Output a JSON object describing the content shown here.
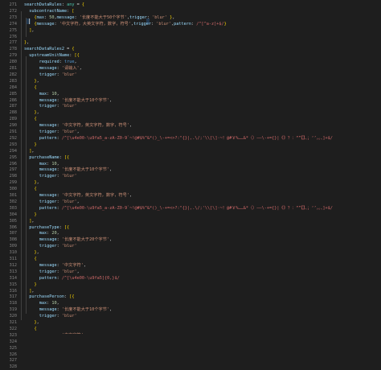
{
  "editor": {
    "lines": [
      {
        "n": "271",
        "segs": [
          [
            "k",
            "searchDataRules"
          ],
          [
            "p",
            ": "
          ],
          [
            "t",
            "any"
          ],
          [
            "p",
            " = "
          ],
          [
            "b",
            "{"
          ]
        ]
      },
      {
        "n": "272",
        "segs": [
          [
            "p",
            "  "
          ],
          [
            "k",
            "subcontractName"
          ],
          [
            "p",
            ": "
          ],
          [
            "b",
            "["
          ]
        ]
      },
      {
        "n": "273",
        "segs": [
          [
            "p",
            "    "
          ],
          [
            "b",
            "{"
          ],
          [
            "k",
            "max"
          ],
          [
            "p",
            ": "
          ],
          [
            "n",
            "50"
          ],
          [
            "p",
            ","
          ],
          [
            "k",
            "message"
          ],
          [
            "p",
            ": "
          ],
          [
            "s",
            "'长度不能大于50个字节'"
          ],
          [
            "p",
            ","
          ],
          [
            "k",
            "trigger"
          ],
          [
            "p",
            ": "
          ],
          [
            "s",
            "'blur'"
          ],
          [
            "p",
            " "
          ],
          [
            "b",
            "}"
          ],
          [
            "p",
            ","
          ]
        ]
      },
      {
        "n": "274",
        "segs": [
          [
            "p",
            "    "
          ],
          [
            "b",
            "{"
          ],
          [
            "k",
            "message"
          ],
          [
            "p",
            ": "
          ],
          [
            "s",
            "'中文字符，大英文字符，数字，符号'"
          ],
          [
            "p",
            ","
          ],
          [
            "k",
            "trigger"
          ],
          [
            "p",
            ": "
          ],
          [
            "s",
            "'blur'"
          ],
          [
            "p",
            ","
          ],
          [
            "k",
            "pattern"
          ],
          [
            "p",
            ": "
          ],
          [
            "r",
            "/^[^a-z]+$/"
          ],
          [
            "b",
            "}"
          ]
        ]
      },
      {
        "n": "275",
        "segs": [
          [
            "p",
            "  "
          ],
          [
            "b",
            "]"
          ],
          [
            "p",
            ","
          ]
        ]
      },
      {
        "n": "276",
        "segs": []
      },
      {
        "n": "277",
        "segs": [
          [
            "b",
            "}"
          ],
          [
            "p",
            ","
          ]
        ]
      },
      {
        "n": "278",
        "segs": [
          [
            "k",
            "searchDataRules2"
          ],
          [
            "p",
            " = "
          ],
          [
            "b",
            "{"
          ]
        ]
      },
      {
        "n": "279",
        "segs": [
          [
            "p",
            "  "
          ],
          [
            "k",
            "upstreamUnitName"
          ],
          [
            "p",
            ": "
          ],
          [
            "b",
            "[{"
          ]
        ]
      },
      {
        "n": "280",
        "segs": [
          [
            "p",
            "      "
          ],
          [
            "k",
            "required"
          ],
          [
            "p",
            ": "
          ],
          [
            "kw",
            "true"
          ],
          [
            "p",
            ","
          ]
        ]
      },
      {
        "n": "281",
        "segs": [
          [
            "p",
            "      "
          ],
          [
            "k",
            "message"
          ],
          [
            "p",
            ": "
          ],
          [
            "s",
            "'请输入'"
          ],
          [
            "p",
            ","
          ]
        ]
      },
      {
        "n": "282",
        "segs": [
          [
            "p",
            "      "
          ],
          [
            "k",
            "trigger"
          ],
          [
            "p",
            ": "
          ],
          [
            "s",
            "'blur'"
          ]
        ]
      },
      {
        "n": "283",
        "segs": [
          [
            "p",
            "    "
          ],
          [
            "b",
            "}"
          ],
          [
            "p",
            ","
          ]
        ]
      },
      {
        "n": "284",
        "segs": [
          [
            "p",
            "    "
          ],
          [
            "b",
            "{"
          ]
        ]
      },
      {
        "n": "285",
        "segs": [
          [
            "p",
            "      "
          ],
          [
            "k",
            "max"
          ],
          [
            "p",
            ": "
          ],
          [
            "n",
            "10"
          ],
          [
            "p",
            ","
          ]
        ]
      },
      {
        "n": "286",
        "segs": [
          [
            "p",
            "      "
          ],
          [
            "k",
            "message"
          ],
          [
            "p",
            ": "
          ],
          [
            "s",
            "'长度不能大于10个字节'"
          ],
          [
            "p",
            ","
          ]
        ]
      },
      {
        "n": "287",
        "segs": [
          [
            "p",
            "      "
          ],
          [
            "k",
            "trigger"
          ],
          [
            "p",
            ": "
          ],
          [
            "s",
            "'blur'"
          ]
        ]
      },
      {
        "n": "288",
        "segs": [
          [
            "p",
            "    "
          ],
          [
            "b",
            "}"
          ],
          [
            "p",
            ","
          ]
        ]
      },
      {
        "n": "289",
        "segs": [
          [
            "p",
            "    "
          ],
          [
            "b",
            "{"
          ]
        ]
      },
      {
        "n": "290",
        "segs": [
          [
            "p",
            "      "
          ],
          [
            "k",
            "message"
          ],
          [
            "p",
            ": "
          ],
          [
            "s",
            "'中文字符，英文字符，数字，符号'"
          ],
          [
            "p",
            ","
          ]
        ]
      },
      {
        "n": "291",
        "segs": [
          [
            "p",
            "      "
          ],
          [
            "k",
            "trigger"
          ],
          [
            "p",
            ": "
          ],
          [
            "s",
            "'blur'"
          ],
          [
            "p",
            ","
          ]
        ]
      },
      {
        "n": "292",
        "segs": [
          [
            "p",
            "      "
          ],
          [
            "k",
            "pattern"
          ],
          [
            "p",
            ": "
          ],
          [
            "r",
            "/^[\\u4e00-\\u9fa5_a-zA-Z0-9`~!@#$%^&*()_\\-+=<>?:\"{}|,.\\/;'\\\\[\\]·~！@#￥%……&*（）——\\-+={}|《》？：“”【】、；‘’，。、]+$/"
          ]
        ]
      },
      {
        "n": "293",
        "segs": [
          [
            "p",
            "    "
          ],
          [
            "b",
            "}"
          ]
        ]
      },
      {
        "n": "294",
        "segs": [
          [
            "p",
            "  "
          ],
          [
            "b",
            "]"
          ],
          [
            "p",
            ","
          ]
        ]
      },
      {
        "n": "295",
        "segs": [
          [
            "p",
            "  "
          ],
          [
            "k",
            "purchaseName"
          ],
          [
            "p",
            ": "
          ],
          [
            "b",
            "[{"
          ]
        ]
      },
      {
        "n": "296",
        "segs": [
          [
            "p",
            "      "
          ],
          [
            "k",
            "max"
          ],
          [
            "p",
            ": "
          ],
          [
            "n",
            "10"
          ],
          [
            "p",
            ","
          ]
        ]
      },
      {
        "n": "297",
        "segs": [
          [
            "p",
            "      "
          ],
          [
            "k",
            "message"
          ],
          [
            "p",
            ": "
          ],
          [
            "s",
            "'长度不能大于10个字节'"
          ],
          [
            "p",
            ","
          ]
        ]
      },
      {
        "n": "298",
        "segs": [
          [
            "p",
            "      "
          ],
          [
            "k",
            "trigger"
          ],
          [
            "p",
            ": "
          ],
          [
            "s",
            "'blur'"
          ]
        ]
      },
      {
        "n": "299",
        "segs": [
          [
            "p",
            "    "
          ],
          [
            "b",
            "}"
          ],
          [
            "p",
            ","
          ]
        ]
      },
      {
        "n": "300",
        "segs": [
          [
            "p",
            "    "
          ],
          [
            "b",
            "{"
          ]
        ]
      },
      {
        "n": "301",
        "segs": [
          [
            "p",
            "      "
          ],
          [
            "k",
            "message"
          ],
          [
            "p",
            ": "
          ],
          [
            "s",
            "'中文字符，英文字符，数字，符号'"
          ],
          [
            "p",
            ","
          ]
        ]
      },
      {
        "n": "302",
        "segs": [
          [
            "p",
            "      "
          ],
          [
            "k",
            "trigger"
          ],
          [
            "p",
            ": "
          ],
          [
            "s",
            "'blur'"
          ],
          [
            "p",
            ","
          ]
        ]
      },
      {
        "n": "303",
        "segs": [
          [
            "p",
            "      "
          ],
          [
            "k",
            "pattern"
          ],
          [
            "p",
            ": "
          ],
          [
            "r",
            "/^[\\u4e00-\\u9fa5_a-zA-Z0-9`~!@#$%^&*()_\\-+=<>?:\"{}|,.\\/;'\\\\[\\]·~！@#￥%……&*（）——\\-+={}|《》？：“”【】、；‘’，。、]+$/"
          ]
        ]
      },
      {
        "n": "304",
        "segs": [
          [
            "p",
            "    "
          ],
          [
            "b",
            "}"
          ]
        ]
      },
      {
        "n": "305",
        "segs": [
          [
            "p",
            "  "
          ],
          [
            "b",
            "]"
          ],
          [
            "p",
            ","
          ]
        ]
      },
      {
        "n": "306",
        "segs": [
          [
            "p",
            "  "
          ],
          [
            "k",
            "purchaseType"
          ],
          [
            "p",
            ": "
          ],
          [
            "b",
            "[{"
          ]
        ]
      },
      {
        "n": "307",
        "segs": [
          [
            "p",
            "      "
          ],
          [
            "k",
            "max"
          ],
          [
            "p",
            ": "
          ],
          [
            "n",
            "20"
          ],
          [
            "p",
            ","
          ]
        ]
      },
      {
        "n": "308",
        "segs": [
          [
            "p",
            "      "
          ],
          [
            "k",
            "message"
          ],
          [
            "p",
            ": "
          ],
          [
            "s",
            "'长度不能大于20个字节'"
          ],
          [
            "p",
            ","
          ]
        ]
      },
      {
        "n": "309",
        "segs": [
          [
            "p",
            "      "
          ],
          [
            "k",
            "trigger"
          ],
          [
            "p",
            ": "
          ],
          [
            "s",
            "'blur'"
          ]
        ]
      },
      {
        "n": "310",
        "segs": [
          [
            "p",
            "    "
          ],
          [
            "b",
            "}"
          ],
          [
            "p",
            ","
          ]
        ]
      },
      {
        "n": "311",
        "segs": [
          [
            "p",
            "    "
          ],
          [
            "b",
            "{"
          ]
        ]
      },
      {
        "n": "312",
        "segs": [
          [
            "p",
            "      "
          ],
          [
            "k",
            "message"
          ],
          [
            "p",
            ": "
          ],
          [
            "s",
            "'中文字符'"
          ],
          [
            "p",
            ","
          ]
        ]
      },
      {
        "n": "313",
        "segs": [
          [
            "p",
            "      "
          ],
          [
            "k",
            "trigger"
          ],
          [
            "p",
            ": "
          ],
          [
            "s",
            "'blur'"
          ],
          [
            "p",
            ","
          ]
        ]
      },
      {
        "n": "314",
        "segs": [
          [
            "p",
            "      "
          ],
          [
            "k",
            "pattern"
          ],
          [
            "p",
            ": "
          ],
          [
            "r",
            "/^[\\u4e00-\\u9fa5]{0,}$/"
          ]
        ]
      },
      {
        "n": "315",
        "segs": [
          [
            "p",
            "    "
          ],
          [
            "b",
            "}"
          ]
        ]
      },
      {
        "n": "316",
        "segs": [
          [
            "p",
            "  "
          ],
          [
            "b",
            "]"
          ],
          [
            "p",
            ","
          ]
        ]
      },
      {
        "n": "317",
        "segs": [
          [
            "p",
            "  "
          ],
          [
            "k",
            "purchasePerson"
          ],
          [
            "p",
            ": "
          ],
          [
            "b",
            "[{"
          ]
        ]
      },
      {
        "n": "318",
        "segs": [
          [
            "p",
            "      "
          ],
          [
            "k",
            "max"
          ],
          [
            "p",
            ": "
          ],
          [
            "n",
            "10"
          ],
          [
            "p",
            ","
          ]
        ]
      },
      {
        "n": "319",
        "segs": [
          [
            "p",
            "      "
          ],
          [
            "k",
            "message"
          ],
          [
            "p",
            ": "
          ],
          [
            "s",
            "'长度不能大于10个字节'"
          ],
          [
            "p",
            ","
          ]
        ]
      },
      {
        "n": "320",
        "segs": [
          [
            "p",
            "      "
          ],
          [
            "k",
            "trigger"
          ],
          [
            "p",
            ": "
          ],
          [
            "s",
            "'blur'"
          ]
        ]
      },
      {
        "n": "321",
        "segs": [
          [
            "p",
            "    "
          ],
          [
            "b",
            "}"
          ],
          [
            "p",
            ","
          ]
        ]
      },
      {
        "n": "322",
        "segs": [
          [
            "p",
            "    "
          ],
          [
            "b",
            "{"
          ]
        ]
      },
      {
        "n": "323",
        "segs": [
          [
            "p",
            "      "
          ],
          [
            "k",
            "message"
          ],
          [
            "p",
            ": "
          ],
          [
            "s",
            "'中文字符'"
          ],
          [
            "p",
            ","
          ]
        ]
      },
      {
        "n": "324",
        "segs": [
          [
            "p",
            "      "
          ],
          [
            "k",
            "trigger"
          ],
          [
            "p",
            ": "
          ],
          [
            "s",
            "'blur'"
          ],
          [
            "p",
            ","
          ]
        ]
      },
      {
        "n": "325",
        "segs": [
          [
            "p",
            "      "
          ],
          [
            "k",
            "pattern"
          ],
          [
            "p",
            ": "
          ],
          [
            "r",
            "/^[\\u4e00-\\u9fa5]{0,}$/"
          ],
          [
            "p",
            ","
          ]
        ]
      },
      {
        "n": "326",
        "segs": [
          [
            "p",
            "    "
          ],
          [
            "b",
            "}"
          ]
        ]
      },
      {
        "n": "327",
        "segs": [
          [
            "p",
            "  "
          ],
          [
            "b",
            "]"
          ]
        ]
      },
      {
        "n": "328",
        "segs": [
          [
            "b",
            "}"
          ]
        ]
      }
    ]
  }
}
